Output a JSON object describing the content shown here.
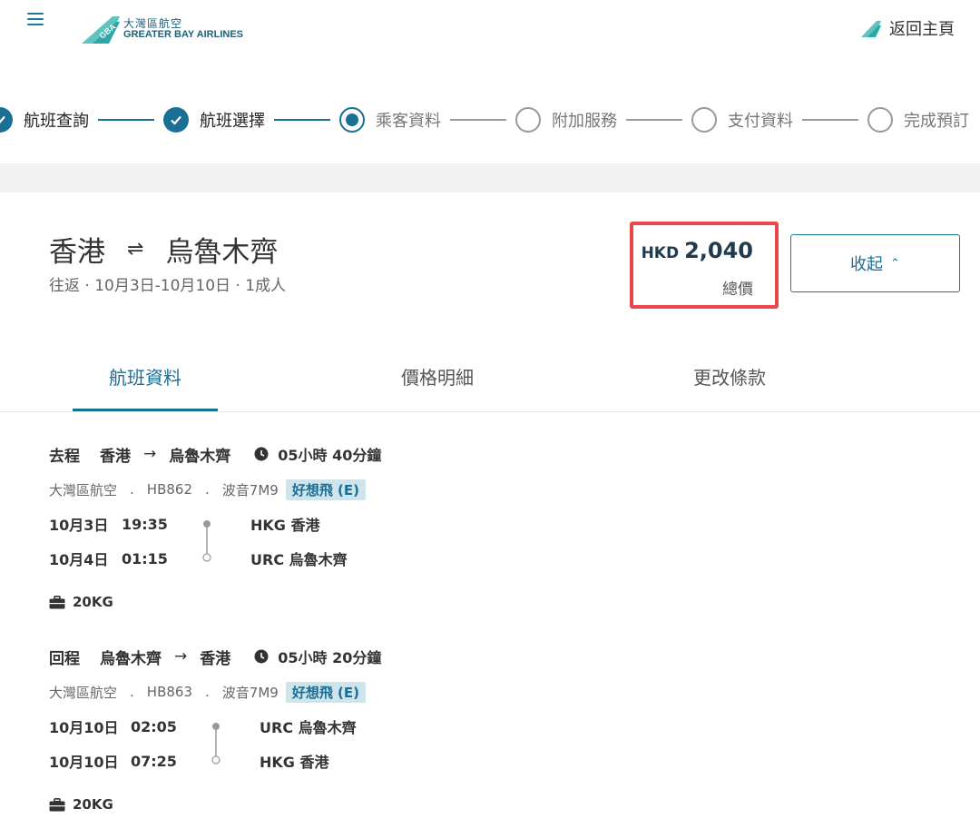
{
  "header": {
    "logo_cn": "大灣區航空",
    "logo_en": "GREATER BAY AIRLINES",
    "logo_mark_text": "GBA",
    "home_label": "返回主頁"
  },
  "stepper": {
    "steps": [
      {
        "label": "航班查詢",
        "state": "done"
      },
      {
        "label": "航班選擇",
        "state": "done"
      },
      {
        "label": "乘客資料",
        "state": "current"
      },
      {
        "label": "附加服務",
        "state": "todo"
      },
      {
        "label": "支付資料",
        "state": "todo"
      },
      {
        "label": "完成預訂",
        "state": "todo"
      }
    ]
  },
  "summary": {
    "origin": "香港",
    "destination": "烏魯木齊",
    "swap_symbol": "⇌",
    "subtitle": "往返 · 10月3日-10月10日 · 1成人",
    "price_currency": "HKD",
    "price_amount": "2,040",
    "price_label": "總價",
    "collapse_label": "收起",
    "collapse_chevron": "⌃"
  },
  "tabs": [
    {
      "label": "航班資料",
      "active": true
    },
    {
      "label": "價格明細",
      "active": false
    },
    {
      "label": "更改條款",
      "active": false
    }
  ],
  "legs": [
    {
      "type": "去程",
      "from": "香港",
      "to": "烏魯木齊",
      "arrow": "→",
      "duration": "05小時 40分鐘",
      "airline": "大灣區航空",
      "flight_no": "HB862",
      "aircraft": "波音7M9",
      "cabin": "好想飛 (E)",
      "segments": [
        {
          "date": "10月3日",
          "time": "19:35",
          "airport": "HKG 香港"
        },
        {
          "date": "10月4日",
          "time": "01:15",
          "airport": "URC 烏魯木齊"
        }
      ],
      "baggage": "20KG"
    },
    {
      "type": "回程",
      "from": "烏魯木齊",
      "to": "香港",
      "arrow": "→",
      "duration": "05小時 20分鐘",
      "airline": "大灣區航空",
      "flight_no": "HB863",
      "aircraft": "波音7M9",
      "cabin": "好想飛 (E)",
      "segments": [
        {
          "date": "10月10日",
          "time": "02:05",
          "airport": "URC 烏魯木齊"
        },
        {
          "date": "10月10日",
          "time": "07:25",
          "airport": "HKG 香港"
        }
      ],
      "baggage": "20KG"
    }
  ],
  "colors": {
    "brand": "#1a6f95",
    "highlight_border": "#e8484b",
    "cabin_badge_bg": "#cfe3ea"
  },
  "icons": [
    "menu-icon",
    "logo-icon",
    "plane-tail-icon",
    "check-icon",
    "clock-icon",
    "suitcase-icon"
  ]
}
